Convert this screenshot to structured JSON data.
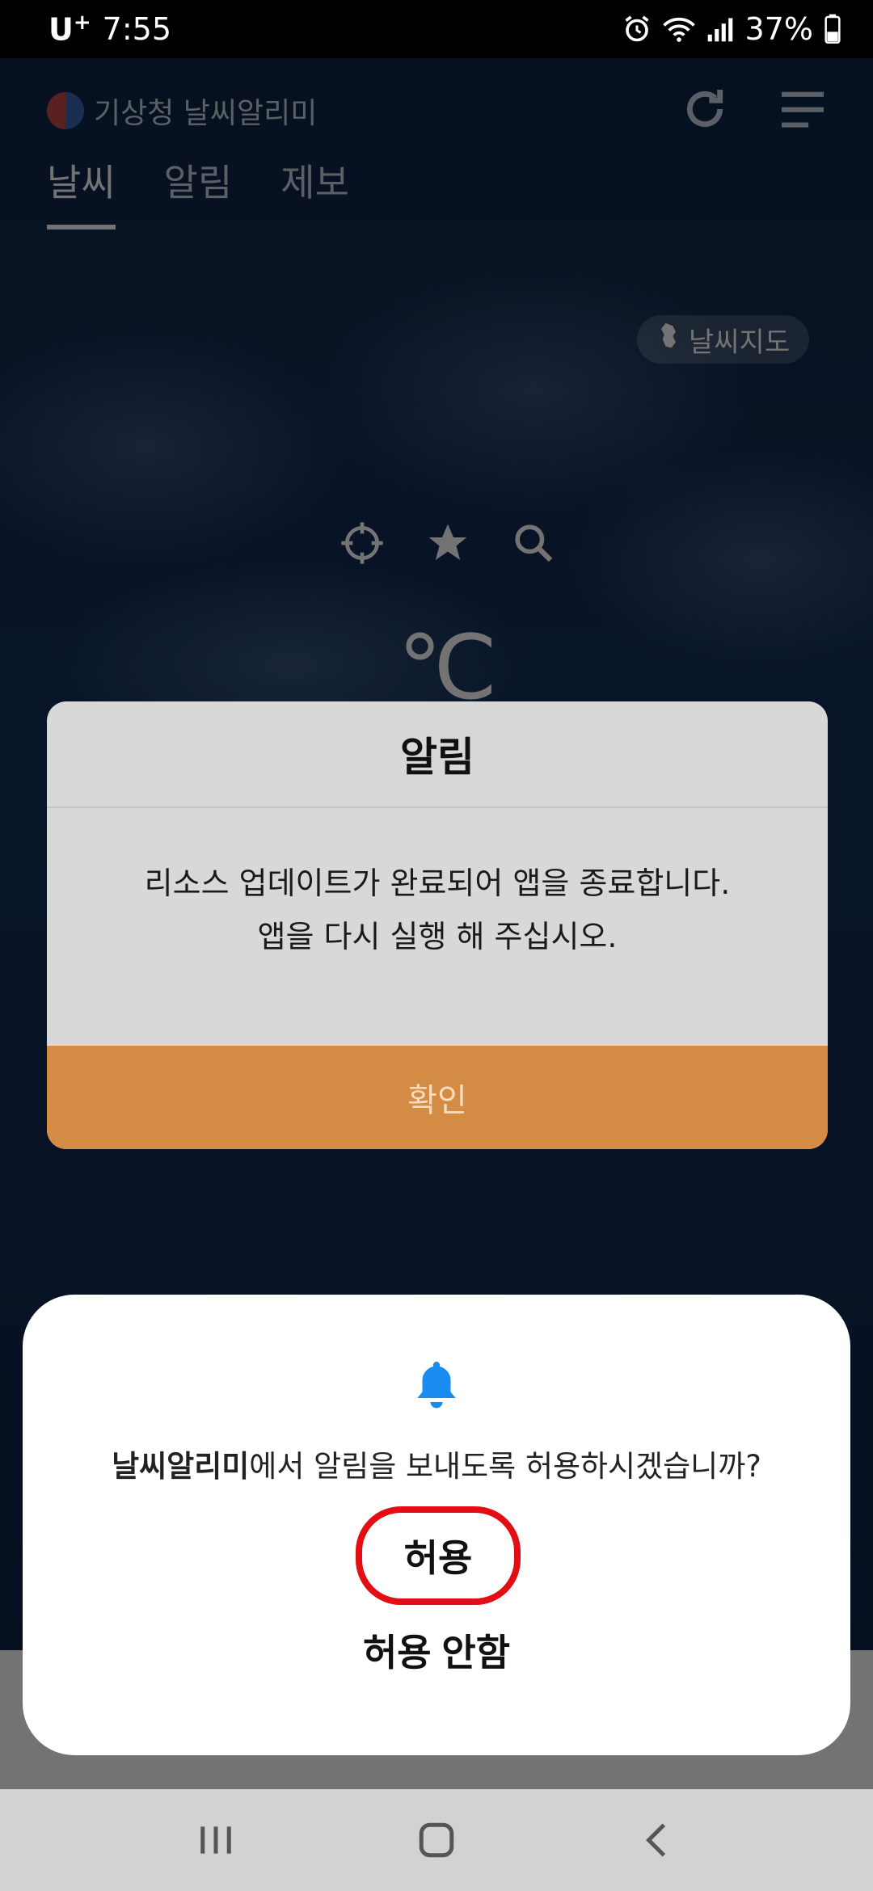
{
  "status_bar": {
    "carrier": "U",
    "carrier_sup": "+",
    "time": "7:55",
    "battery": "37%",
    "icons": [
      "alarm-icon",
      "wifi-icon",
      "signal-icon",
      "battery-icon"
    ]
  },
  "app": {
    "logo_text": "기상청 날씨알리미",
    "tabs": [
      {
        "label": "날씨",
        "active": true
      },
      {
        "label": "알림",
        "active": false
      },
      {
        "label": "제보",
        "active": false
      }
    ],
    "map_chip_label": "날씨지도",
    "temperature_unit": "℃"
  },
  "alert_dialog": {
    "title": "알림",
    "message_line1": "리소스 업데이트가 완료되어 앱을 종료합니다.",
    "message_line2": "앱을 다시 실행 해 주십시오.",
    "confirm_label": "확인",
    "confirm_color": "#d48c44"
  },
  "permission_sheet": {
    "app_name": "날씨알리미",
    "question_suffix": "에서 알림을 보내도록 허용하시겠습니까?",
    "allow_label": "허용",
    "deny_label": "허용 안함",
    "bell_color": "#1a8cf0",
    "highlight_color": "#e30d14"
  }
}
